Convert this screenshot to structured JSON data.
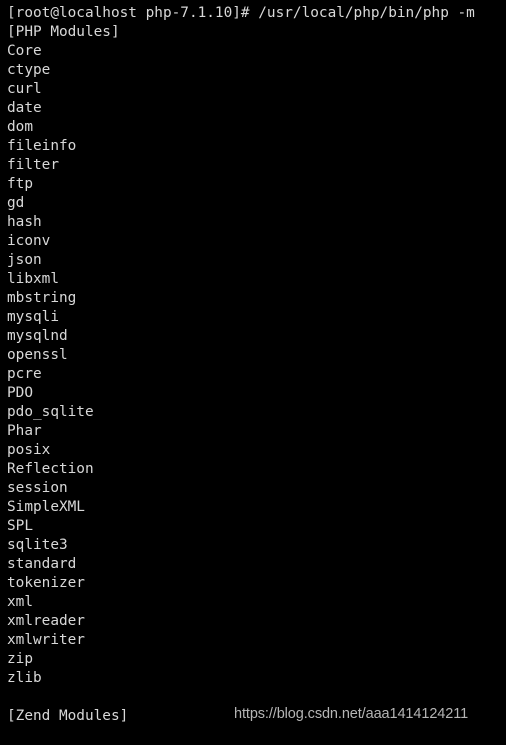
{
  "terminal": {
    "background_color": "#000000",
    "foreground_color": "#d8d8d8",
    "prompt_line": "[root@localhost php-7.1.10]# /usr/local/php/bin/php -m",
    "lines": [
      "[root@localhost php-7.1.10]# /usr/local/php/bin/php -m",
      "[PHP Modules]",
      "Core",
      "ctype",
      "curl",
      "date",
      "dom",
      "fileinfo",
      "filter",
      "ftp",
      "gd",
      "hash",
      "iconv",
      "json",
      "libxml",
      "mbstring",
      "mysqli",
      "mysqlnd",
      "openssl",
      "pcre",
      "PDO",
      "pdo_sqlite",
      "Phar",
      "posix",
      "Reflection",
      "session",
      "SimpleXML",
      "SPL",
      "sqlite3",
      "standard",
      "tokenizer",
      "xml",
      "xmlreader",
      "xmlwriter",
      "zip",
      "zlib",
      "",
      "[Zend Modules]",
      ""
    ],
    "section_headers": [
      "[PHP Modules]",
      "[Zend Modules]"
    ],
    "php_modules": [
      "Core",
      "ctype",
      "curl",
      "date",
      "dom",
      "fileinfo",
      "filter",
      "ftp",
      "gd",
      "hash",
      "iconv",
      "json",
      "libxml",
      "mbstring",
      "mysqli",
      "mysqlnd",
      "openssl",
      "pcre",
      "PDO",
      "pdo_sqlite",
      "Phar",
      "posix",
      "Reflection",
      "session",
      "SimpleXML",
      "SPL",
      "sqlite3",
      "standard",
      "tokenizer",
      "xml",
      "xmlreader",
      "xmlwriter",
      "zip",
      "zlib"
    ],
    "zend_modules": []
  },
  "watermark": {
    "text": "https://blog.csdn.net/aaa1414124211",
    "color": "#b5b5b5"
  }
}
